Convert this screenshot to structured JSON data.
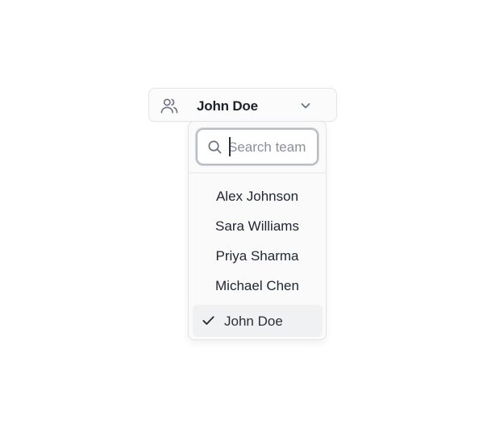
{
  "trigger": {
    "icon": "team-icon",
    "value": "John Doe",
    "chevron": "chevron-down-icon"
  },
  "search": {
    "icon": "search-icon",
    "placeholder": "Search team",
    "value": ""
  },
  "options": [
    {
      "label": "Alex Johnson",
      "selected": false
    },
    {
      "label": "Sara Williams",
      "selected": false
    },
    {
      "label": "Priya Sharma",
      "selected": false
    },
    {
      "label": "Michael Chen",
      "selected": false
    }
  ],
  "selected_option": {
    "label": "John Doe",
    "icon": "check-icon",
    "selected": true
  },
  "colors": {
    "text": "#1f2530",
    "muted": "#6b7280",
    "border": "#e2e4e8",
    "selected_bg": "#f0f1f3"
  }
}
